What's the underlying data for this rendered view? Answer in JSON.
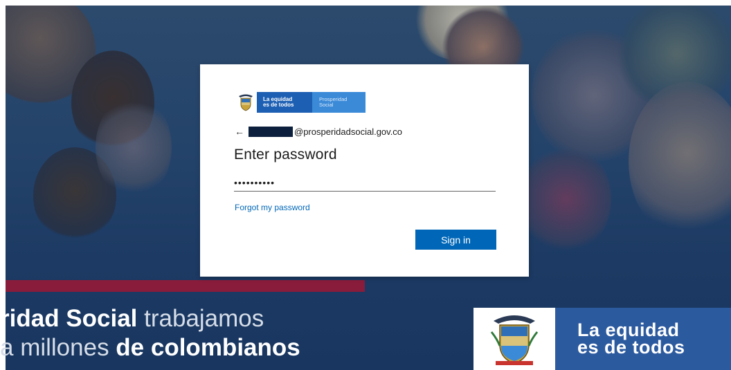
{
  "background": {
    "tagline_line1_part1": "ridad Social",
    "tagline_line1_part2": " trabajamos",
    "tagline_line2_part1": "a millones ",
    "tagline_line2_part2": "de colombianos",
    "footer_line1": "La equidad",
    "footer_line2": "es de todos",
    "colors": {
      "banner": "#8a1c3b",
      "footer_blue": "#2c5a9f",
      "overlay": "#24436a"
    }
  },
  "login": {
    "logo": {
      "equidad_line1": "La equidad",
      "equidad_line2": "es de todos",
      "prosperidad_line1": "Prosperidad",
      "prosperidad_line2": "Social"
    },
    "back_icon": "←",
    "email_domain": "@prosperidadsocial.gov.co",
    "title": "Enter password",
    "password_value": "••••••••••",
    "forgot_link": "Forgot my password",
    "signin_label": "Sign in",
    "colors": {
      "primary": "#0067b8"
    }
  }
}
